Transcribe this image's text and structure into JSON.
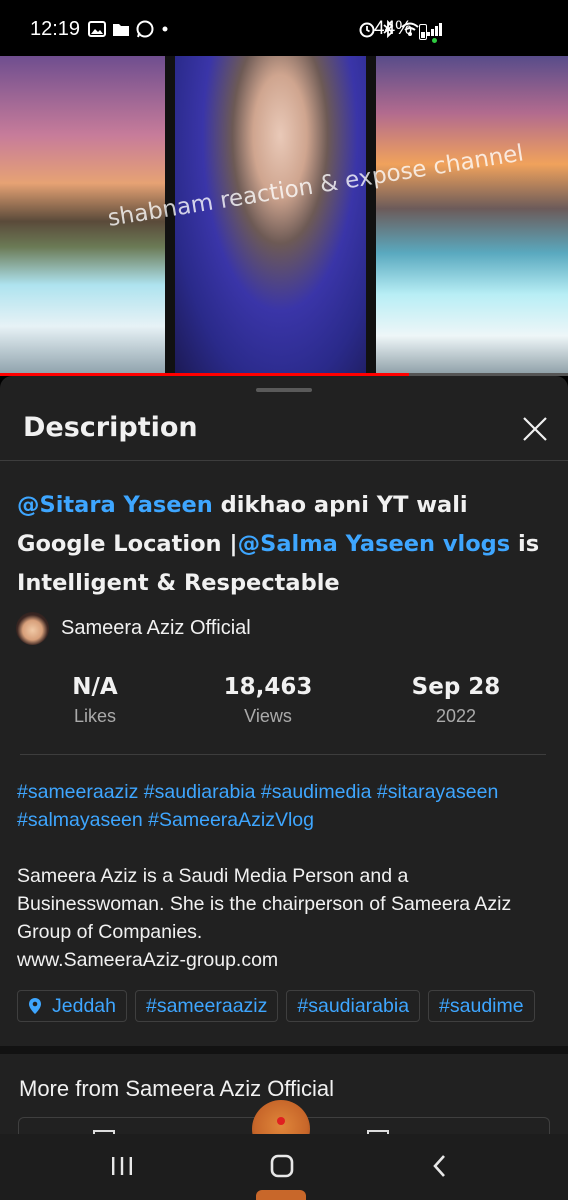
{
  "status_bar": {
    "time": "12:19",
    "battery": "44%"
  },
  "video": {
    "watermark": "shabnam reaction & expose channel",
    "progress": 0.72
  },
  "sheet": {
    "title": "Description"
  },
  "video_title": {
    "mention1": "@Sitara Yaseen",
    "text1": " dikhao apni YT wali Google Location |",
    "mention2": "@Salma Yaseen vlogs",
    "text2": " is Intelligent & Respectable"
  },
  "channel": {
    "name": "Sameera Aziz Official"
  },
  "stats": [
    {
      "value": "N/A",
      "label": "Likes"
    },
    {
      "value": "18,463",
      "label": "Views"
    },
    {
      "value": "Sep 28",
      "label": "2022"
    }
  ],
  "hashtags": "#sameeraaziz #saudiarabia #saudimedia #sitarayaseen #salmayaseen #SameeraAzizVlog",
  "description": {
    "line1": "Sameera Aziz is a Saudi Media Person and a Businesswoman. She is the chairperson of Sameera Aziz Group of Companies.",
    "line2": "www.SameeraAziz-group.com"
  },
  "chips": {
    "location": "Jeddah",
    "tag1": "#sameeraaziz",
    "tag2": "#saudiarabia",
    "tag3": "#saudime"
  },
  "more_section": {
    "heading": "More from Sameera Aziz Official"
  },
  "colors": {
    "link": "#3ea6ff",
    "progress": "#ff0000",
    "sheet_bg": "#212121"
  }
}
